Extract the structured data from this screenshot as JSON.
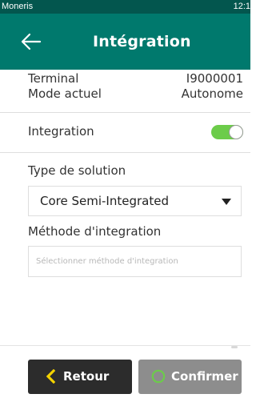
{
  "status_bar": {
    "app_name": "Moneris",
    "time": "12:1"
  },
  "header": {
    "title": "Intégration",
    "back_icon": "back-arrow-icon"
  },
  "info": {
    "terminal_label": "Terminal",
    "terminal_value": "I9000001",
    "mode_label": "Mode actuel",
    "mode_value": "Autonome"
  },
  "integration_toggle": {
    "label": "Integration",
    "enabled": true,
    "color": "#6ccc4a"
  },
  "solution": {
    "label": "Type de solution",
    "selected": "Core Semi-Integrated"
  },
  "method": {
    "label": "Méthode d'integration",
    "placeholder": "Sélectionner méthode d'integration",
    "value": ""
  },
  "footer": {
    "back_label": "Retour",
    "confirm_label": "Confirmer",
    "back_icon": "chevron-left-icon",
    "confirm_icon": "circle-icon"
  },
  "colors": {
    "header": "#00796d",
    "status_bar": "#03564e",
    "accent_yellow": "#f4d300",
    "accent_green": "#6ccc4a"
  }
}
